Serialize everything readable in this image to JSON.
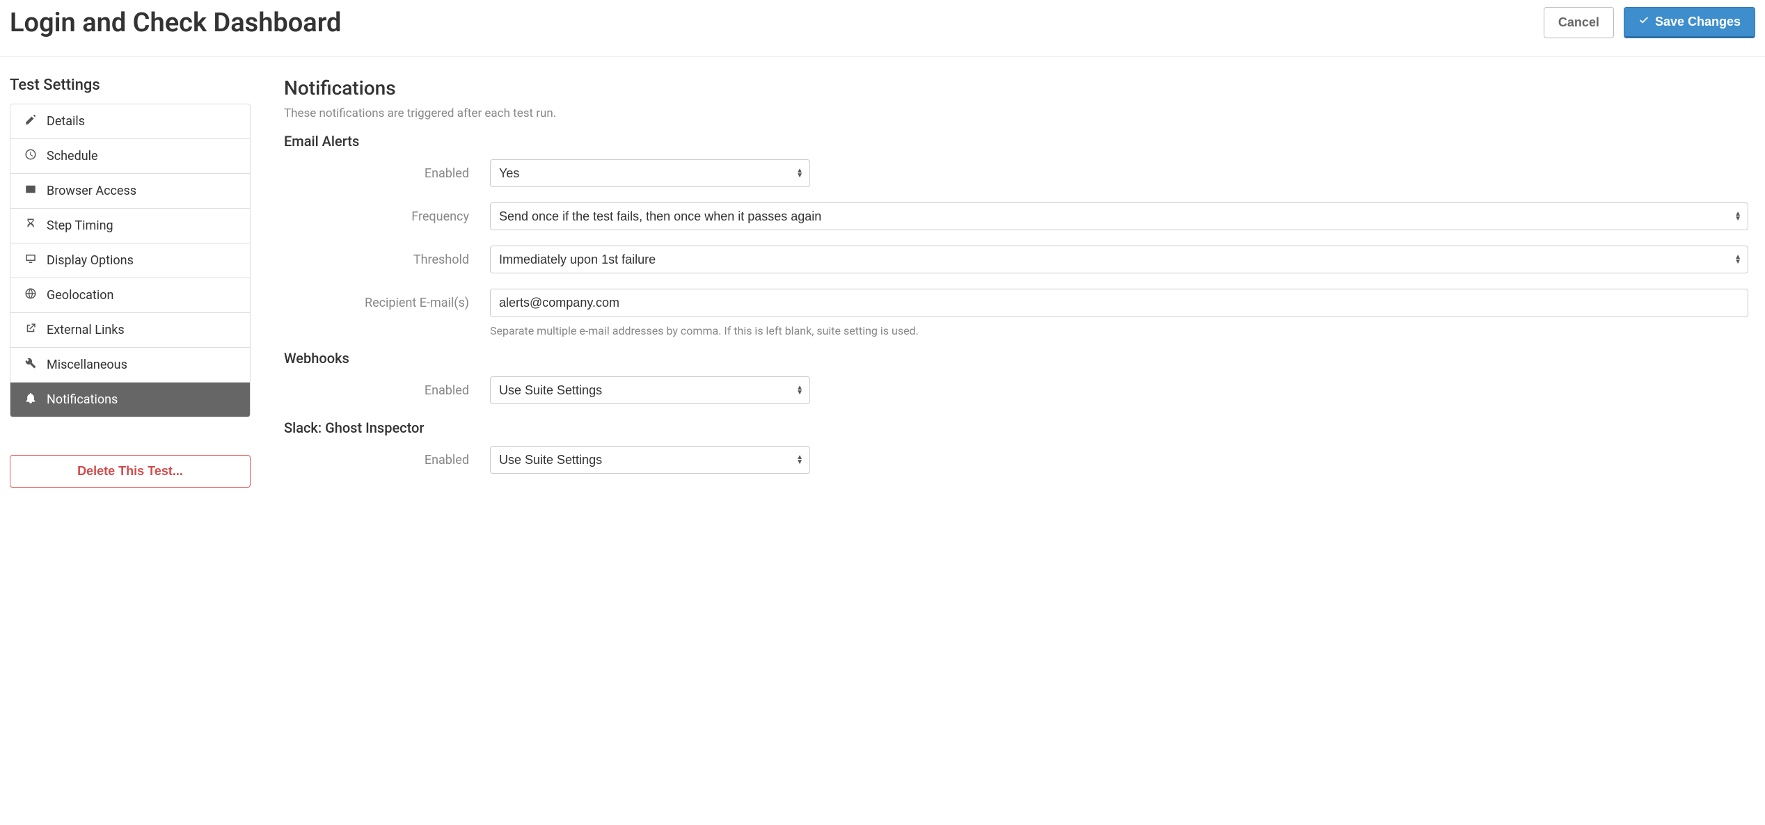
{
  "header": {
    "title": "Login and Check Dashboard",
    "cancel_label": "Cancel",
    "save_label": "Save Changes"
  },
  "sidebar": {
    "title": "Test Settings",
    "items": [
      {
        "label": "Details"
      },
      {
        "label": "Schedule"
      },
      {
        "label": "Browser Access"
      },
      {
        "label": "Step Timing"
      },
      {
        "label": "Display Options"
      },
      {
        "label": "Geolocation"
      },
      {
        "label": "External Links"
      },
      {
        "label": "Miscellaneous"
      },
      {
        "label": "Notifications"
      }
    ],
    "delete_label": "Delete This Test..."
  },
  "main": {
    "heading": "Notifications",
    "subheading": "These notifications are triggered after each test run.",
    "email": {
      "heading": "Email Alerts",
      "enabled_label": "Enabled",
      "enabled_value": "Yes",
      "frequency_label": "Frequency",
      "frequency_value": "Send once if the test fails, then once when it passes again",
      "threshold_label": "Threshold",
      "threshold_value": "Immediately upon 1st failure",
      "recipient_label": "Recipient E-mail(s)",
      "recipient_value": "alerts@company.com",
      "recipient_help": "Separate multiple e-mail addresses by comma. If this is left blank, suite setting is used."
    },
    "webhooks": {
      "heading": "Webhooks",
      "enabled_label": "Enabled",
      "enabled_value": "Use Suite Settings"
    },
    "slack": {
      "heading": "Slack: Ghost Inspector",
      "enabled_label": "Enabled",
      "enabled_value": "Use Suite Settings"
    }
  }
}
